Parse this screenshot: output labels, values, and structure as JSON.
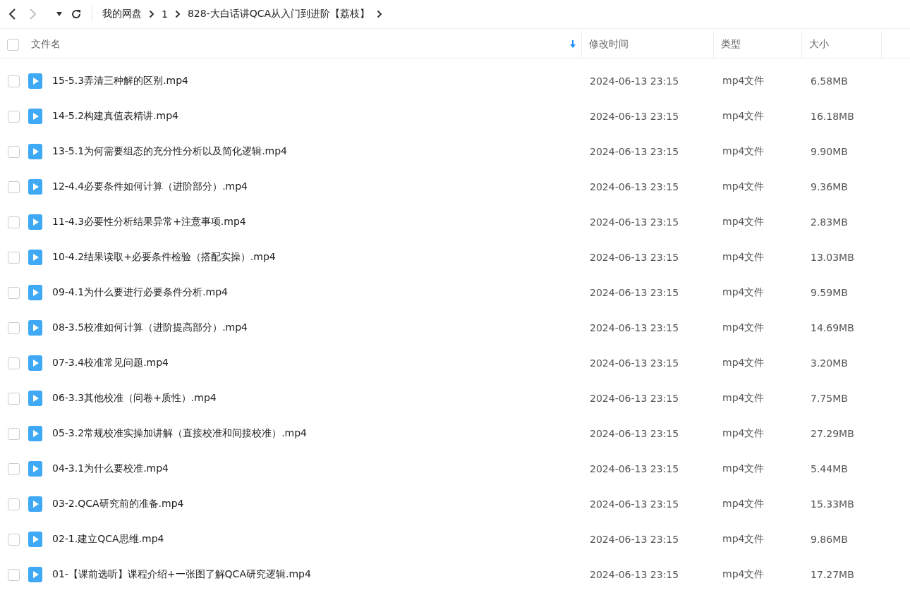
{
  "toolbar": {
    "back_disabled": false,
    "forward_disabled": true
  },
  "breadcrumb": [
    "我的网盘",
    "1",
    "828-大白话讲QCA从入门到进阶【荔枝】"
  ],
  "table": {
    "select_all_checked": false,
    "columns": [
      "文件名",
      "修改时间",
      "类型",
      "大小"
    ],
    "rows": [
      {
        "name": "15-5.3弄清三种解的区别.mp4",
        "time": "2024-06-13 23:15",
        "type": "mp4文件",
        "size": "6.58MB",
        "checked": false
      },
      {
        "name": "14-5.2构建真值表精讲.mp4",
        "time": "2024-06-13 23:15",
        "type": "mp4文件",
        "size": "16.18MB",
        "checked": false
      },
      {
        "name": "13-5.1为何需要组态的充分性分析以及简化逻辑.mp4",
        "time": "2024-06-13 23:15",
        "type": "mp4文件",
        "size": "9.90MB",
        "checked": false
      },
      {
        "name": "12-4.4必要条件如何计算（进阶部分）.mp4",
        "time": "2024-06-13 23:15",
        "type": "mp4文件",
        "size": "9.36MB",
        "checked": false
      },
      {
        "name": "11-4.3必要性分析结果异常+注意事项.mp4",
        "time": "2024-06-13 23:15",
        "type": "mp4文件",
        "size": "2.83MB",
        "checked": false
      },
      {
        "name": "10-4.2结果读取+必要条件检验（搭配实操）.mp4",
        "time": "2024-06-13 23:15",
        "type": "mp4文件",
        "size": "13.03MB",
        "checked": false
      },
      {
        "name": "09-4.1为什么要进行必要条件分析.mp4",
        "time": "2024-06-13 23:15",
        "type": "mp4文件",
        "size": "9.59MB",
        "checked": false
      },
      {
        "name": "08-3.5校准如何计算（进阶提高部分）.mp4",
        "time": "2024-06-13 23:15",
        "type": "mp4文件",
        "size": "14.69MB",
        "checked": false
      },
      {
        "name": "07-3.4校准常见问题.mp4",
        "time": "2024-06-13 23:15",
        "type": "mp4文件",
        "size": "3.20MB",
        "checked": false
      },
      {
        "name": "06-3.3其他校准（问卷+质性）.mp4",
        "time": "2024-06-13 23:15",
        "type": "mp4文件",
        "size": "7.75MB",
        "checked": false
      },
      {
        "name": "05-3.2常规校准实操加讲解（直接校准和间接校准）.mp4",
        "time": "2024-06-13 23:15",
        "type": "mp4文件",
        "size": "27.29MB",
        "checked": false
      },
      {
        "name": "04-3.1为什么要校准.mp4",
        "time": "2024-06-13 23:15",
        "type": "mp4文件",
        "size": "5.44MB",
        "checked": false
      },
      {
        "name": "03-2.QCA研究前的准备.mp4",
        "time": "2024-06-13 23:15",
        "type": "mp4文件",
        "size": "15.33MB",
        "checked": false
      },
      {
        "name": "02-1.建立QCA思维.mp4",
        "time": "2024-06-13 23:15",
        "type": "mp4文件",
        "size": "9.86MB",
        "checked": false
      },
      {
        "name": "01-【课前选听】课程介绍+一张图了解QCA研究逻辑.mp4",
        "time": "2024-06-13 23:15",
        "type": "mp4文件",
        "size": "17.27MB",
        "checked": false
      }
    ]
  }
}
